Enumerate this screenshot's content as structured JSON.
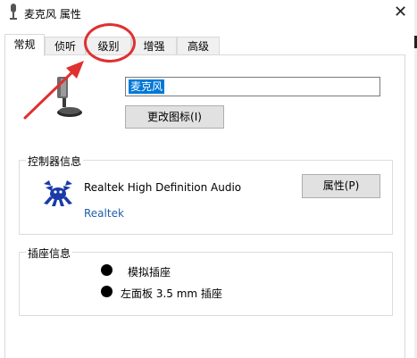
{
  "window": {
    "title": "麦克风 属性",
    "close_glyph": "✕"
  },
  "tabs": [
    {
      "label": "常规",
      "active": true
    },
    {
      "label": "侦听",
      "active": false
    },
    {
      "label": "级别",
      "active": false
    },
    {
      "label": "增强",
      "active": false
    },
    {
      "label": "高级",
      "active": false
    }
  ],
  "device": {
    "name_value": "麦克风",
    "change_icon_label": "更改图标(I)"
  },
  "controller": {
    "group_title": "控制器信息",
    "name": "Realtek High Definition Audio",
    "vendor": "Realtek",
    "properties_label": "属性(P)"
  },
  "jack": {
    "group_title": "插座信息",
    "items": [
      "模拟插座",
      "左面板 3.5 mm 插座"
    ]
  },
  "colors": {
    "annotation": "#e03030",
    "selection": "#0078d7",
    "vendor_link": "#1f5fa8"
  },
  "icons": [
    "microphone-icon",
    "realtek-crab-icon",
    "close-icon",
    "title-mic-icon"
  ]
}
